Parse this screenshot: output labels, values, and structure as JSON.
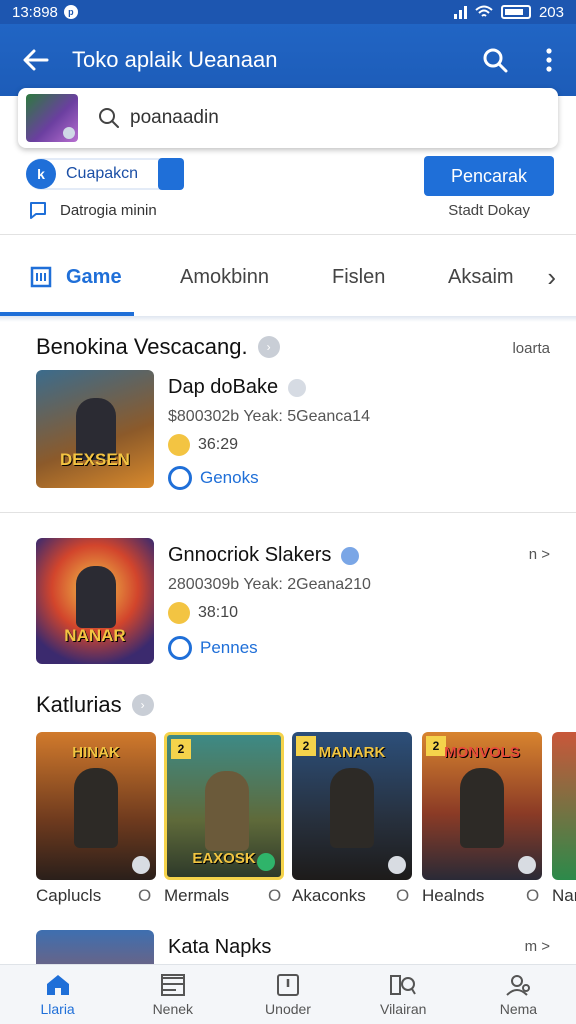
{
  "status": {
    "time": "13:898",
    "battery": "203"
  },
  "header": {
    "title": "Toko aplaik Ueanaan"
  },
  "search": {
    "query": "poanaadin"
  },
  "chips": {
    "pill_label": "Cuapakcn",
    "sub_label": "Datrogia minin",
    "button_label": "Pencarak",
    "right_label": "Stadt Dokay"
  },
  "tabs": [
    {
      "label": "Game"
    },
    {
      "label": "Amokbinn"
    },
    {
      "label": "Fislen"
    },
    {
      "label": "Aksaim"
    }
  ],
  "section1": {
    "title": "Benokina Vescacang.",
    "more": "loarta"
  },
  "apps": [
    {
      "name": "Dap doBake",
      "meta": "$800302b Yeak: 5Geanca14",
      "rating": "36:29",
      "category": "Genoks",
      "cover_title": "DEXSEN"
    },
    {
      "name": "Gnnocriok Slakers",
      "meta": "2800309b Yeak: 2Geana210",
      "rating": "38:10",
      "category": "Pennes",
      "cover_title": "NANAR",
      "more": "n >"
    },
    {
      "name": "Kata Napks",
      "more": "m >"
    }
  ],
  "section2": {
    "title": "Katlurias"
  },
  "carousel": [
    {
      "label": "Caplucls",
      "title": "HINAK"
    },
    {
      "label": "Mermals",
      "title": "EAXOSK"
    },
    {
      "label": "Akaconks",
      "title": "MANARK"
    },
    {
      "label": "Healnds",
      "title": "MONVOLS"
    },
    {
      "label": "Nar"
    }
  ],
  "bottom_nav": [
    {
      "label": "Llaria"
    },
    {
      "label": "Nenek"
    },
    {
      "label": "Unoder"
    },
    {
      "label": "Vilairan"
    },
    {
      "label": "Nema"
    }
  ],
  "colors": {
    "primary": "#1f6fd8",
    "appbar": "#1d5cb8"
  }
}
